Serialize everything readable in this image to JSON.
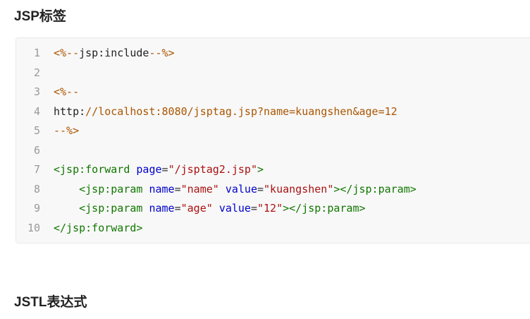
{
  "headings": {
    "top": "JSP标签",
    "bottom": "JSTL表达式"
  },
  "code": {
    "line_numbers": [
      "1",
      "2",
      "3",
      "4",
      "5",
      "6",
      "7",
      "8",
      "9",
      "10"
    ],
    "lines": [
      [
        {
          "t": "<%--",
          "k": "comment"
        },
        {
          "t": "jsp:include",
          "k": "plain"
        },
        {
          "t": "--%>",
          "k": "comment"
        }
      ],
      [],
      [
        {
          "t": "<%--",
          "k": "comment"
        }
      ],
      [
        {
          "t": "http:",
          "k": "plain"
        },
        {
          "t": "//localhost:8080/jsptag.jsp?name=kuangshen&age=12",
          "k": "comment"
        }
      ],
      [
        {
          "t": "--%>",
          "k": "comment"
        }
      ],
      [],
      [
        {
          "t": "<jsp:forward",
          "k": "tag"
        },
        {
          "t": " ",
          "k": "plain"
        },
        {
          "t": "page",
          "k": "attr"
        },
        {
          "t": "=",
          "k": "punct"
        },
        {
          "t": "\"/jsptag2.jsp\"",
          "k": "str"
        },
        {
          "t": ">",
          "k": "tag"
        }
      ],
      [
        {
          "t": "    ",
          "k": "plain"
        },
        {
          "t": "<jsp:param",
          "k": "tag"
        },
        {
          "t": " ",
          "k": "plain"
        },
        {
          "t": "name",
          "k": "attr"
        },
        {
          "t": "=",
          "k": "punct"
        },
        {
          "t": "\"name\"",
          "k": "str"
        },
        {
          "t": " ",
          "k": "plain"
        },
        {
          "t": "value",
          "k": "attr"
        },
        {
          "t": "=",
          "k": "punct"
        },
        {
          "t": "\"kuangshen\"",
          "k": "str"
        },
        {
          "t": "></jsp:param>",
          "k": "tag"
        }
      ],
      [
        {
          "t": "    ",
          "k": "plain"
        },
        {
          "t": "<jsp:param",
          "k": "tag"
        },
        {
          "t": " ",
          "k": "plain"
        },
        {
          "t": "name",
          "k": "attr"
        },
        {
          "t": "=",
          "k": "punct"
        },
        {
          "t": "\"age\"",
          "k": "str"
        },
        {
          "t": " ",
          "k": "plain"
        },
        {
          "t": "value",
          "k": "attr"
        },
        {
          "t": "=",
          "k": "punct"
        },
        {
          "t": "\"12\"",
          "k": "str"
        },
        {
          "t": "></jsp:param>",
          "k": "tag"
        }
      ],
      [
        {
          "t": "</jsp:forward>",
          "k": "tag"
        }
      ]
    ]
  },
  "colors": {
    "comment": "#aa5500",
    "tag": "#117700",
    "attr": "#0000cc",
    "string": "#aa1111",
    "code_background": "#f8f8f8"
  }
}
